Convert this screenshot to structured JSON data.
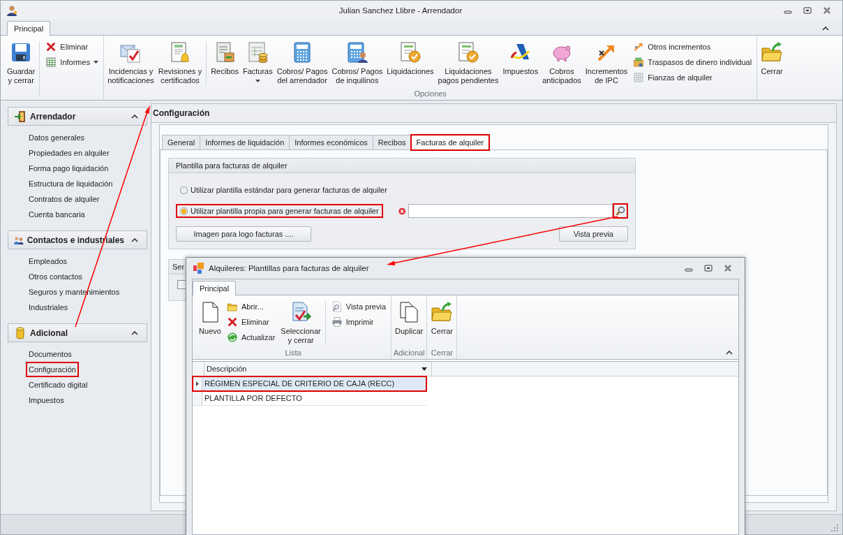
{
  "window": {
    "title": "Julian Sanchez Llibre - Arrendador"
  },
  "ribbon": {
    "tabs": [
      {
        "label": "Principal",
        "selected": true
      }
    ],
    "groups": [
      {
        "items": [
          {
            "kind": "large",
            "label": "Guardar\ny cerrar"
          },
          {
            "kind": "separator"
          },
          {
            "kind": "stack",
            "items": [
              {
                "label": "Eliminar"
              },
              {
                "label": "Informes",
                "dropdown": true
              }
            ]
          }
        ]
      },
      {
        "label": "Opciones",
        "items": [
          {
            "kind": "large",
            "label": "Incidencias y\nnotificaciones"
          },
          {
            "kind": "large",
            "label": "Revisiones y\ncertificados"
          },
          {
            "kind": "separator"
          },
          {
            "kind": "large",
            "label": "Recibos"
          },
          {
            "kind": "large",
            "label": "Facturas",
            "dropdown": true
          },
          {
            "kind": "large",
            "label": "Cobros/ Pagos\ndel arrendador"
          },
          {
            "kind": "large",
            "label": "Cobros/ Pagos\nde inquilinos"
          },
          {
            "kind": "large",
            "label": "Liquidaciones"
          },
          {
            "kind": "large",
            "label": "Liquidaciones\npagos pendientes"
          },
          {
            "kind": "large",
            "label": "Impuestos"
          },
          {
            "kind": "large",
            "label": "Cobros\nanticipados"
          },
          {
            "kind": "large",
            "label": "Incrementos\nde IPC"
          },
          {
            "kind": "stack",
            "items": [
              {
                "label": "Otros incrementos"
              },
              {
                "label": "Traspasos de dinero individual"
              },
              {
                "label": "Fianzas de alquiler"
              }
            ]
          }
        ]
      },
      {
        "items": [
          {
            "kind": "large",
            "label": "Cerrar"
          }
        ]
      }
    ]
  },
  "sidebar": {
    "sections": [
      {
        "title": "Arrendador",
        "expanded": true,
        "items": [
          {
            "label": "Datos generales",
            "highlighted": false
          },
          {
            "label": "Propiedades en alquiler",
            "highlighted": false
          },
          {
            "label": "Forma pago liquidación",
            "highlighted": false
          },
          {
            "label": "Estructura de liquidación",
            "highlighted": false
          },
          {
            "label": "Contratos de alquiler",
            "highlighted": false
          },
          {
            "label": "Cuenta bancaria",
            "highlighted": false
          }
        ]
      },
      {
        "title": "Contactos e industriales",
        "expanded": true,
        "items": [
          {
            "label": "Empleados",
            "highlighted": false
          },
          {
            "label": "Otros contactos",
            "highlighted": false
          },
          {
            "label": "Seguros y mantenimientos",
            "highlighted": false
          },
          {
            "label": "Industriales",
            "highlighted": false
          }
        ]
      },
      {
        "title": "Adicional",
        "expanded": true,
        "items": [
          {
            "label": "Documentos",
            "highlighted": false
          },
          {
            "label": "Configuración",
            "highlighted": true
          },
          {
            "label": "Certificado digital",
            "highlighted": false
          },
          {
            "label": "Impuestos",
            "highlighted": false
          }
        ]
      }
    ]
  },
  "content": {
    "title": "Configuración",
    "tabs": [
      {
        "label": "General",
        "selected": false,
        "highlighted": false
      },
      {
        "label": "Informes de liquidación",
        "selected": false,
        "highlighted": false
      },
      {
        "label": "Informes económicos",
        "selected": false,
        "highlighted": false
      },
      {
        "label": "Recibos",
        "selected": false,
        "highlighted": false
      },
      {
        "label": "Facturas de alquiler",
        "selected": true,
        "highlighted": true
      }
    ],
    "template_group": {
      "title": "Plantilla para facturas de alquiler",
      "radios": [
        {
          "label": "Utilizar plantilla estándar para generar facturas de alquiler",
          "selected": false,
          "highlighted": false
        },
        {
          "label": "Utilizar plantilla propia para generar facturas de alquiler",
          "selected": true,
          "highlighted": true
        }
      ],
      "path_field": {
        "search_highlighted": true
      },
      "buttons": [
        "Imagen para logo facturas ....",
        "Vista previa"
      ]
    },
    "second_group": {
      "title": "Ser",
      "checkbox": {
        "checked": false
      }
    }
  },
  "dialog": {
    "title": "Alquileres: Plantillas para facturas de alquiler",
    "tabs": [
      {
        "label": "Principal",
        "selected": true
      }
    ],
    "groups": [
      {
        "label": "Lista",
        "items": [
          {
            "kind": "large",
            "label": "Nuevo"
          },
          {
            "kind": "stack",
            "items": [
              {
                "label": "Abrir..."
              },
              {
                "label": "Eliminar"
              },
              {
                "label": "Actualizar"
              }
            ]
          },
          {
            "kind": "large",
            "label": "Seleccionar\ny cerrar"
          },
          {
            "kind": "separator"
          },
          {
            "kind": "stack",
            "items": [
              {
                "label": "Vista previa"
              },
              {
                "label": "Imprimir"
              }
            ]
          }
        ]
      },
      {
        "label": "Adicional",
        "items": [
          {
            "kind": "large",
            "label": "Duplicar"
          }
        ]
      },
      {
        "label": "Cerrar",
        "items": [
          {
            "kind": "large",
            "label": "Cerrar"
          }
        ]
      }
    ],
    "grid": {
      "columns": [
        "Descripción"
      ],
      "rows": [
        {
          "cells": [
            "RÉGIMEN ESPECIAL DE CRITERIO DE CAJA (RECC)"
          ],
          "selected": true,
          "highlighted": true
        },
        {
          "cells": [
            "PLANTILLA POR DEFECTO"
          ],
          "selected": false,
          "highlighted": false
        }
      ]
    }
  }
}
